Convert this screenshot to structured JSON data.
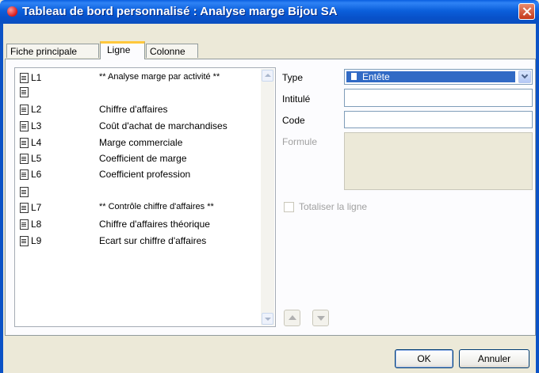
{
  "window": {
    "title": "Tableau de bord personnalisé : Analyse marge Bijou SA"
  },
  "tabs": [
    {
      "label": "Fiche principale"
    },
    {
      "label": "Ligne"
    },
    {
      "label": "Colonne"
    }
  ],
  "lines": [
    {
      "code": "L1",
      "label": "** Analyse marge par activité **"
    },
    {
      "code": "",
      "label": ""
    },
    {
      "code": "L2",
      "label": "Chiffre d'affaires"
    },
    {
      "code": "L3",
      "label": "Coût d'achat de marchandises"
    },
    {
      "code": "L4",
      "label": "Marge commerciale"
    },
    {
      "code": "L5",
      "label": "Coefficient de marge"
    },
    {
      "code": "L6",
      "label": "Coefficient profession"
    },
    {
      "code": "",
      "label": ""
    },
    {
      "code": "L7",
      "label": "** Contrôle chiffre d'affaires **"
    },
    {
      "code": "L8",
      "label": "Chiffre d'affaires théorique"
    },
    {
      "code": "L9",
      "label": "Ecart sur chiffre d'affaires"
    }
  ],
  "form": {
    "type_label": "Type",
    "type_value": "Entête",
    "intitule_label": "Intitulé",
    "intitule_value": "",
    "code_label": "Code",
    "code_value": "",
    "formule_label": "Formule",
    "totaliser_label": "Totaliser la ligne"
  },
  "buttons": {
    "ok": "OK",
    "annuler": "Annuler"
  },
  "colors": {
    "titlebar": "#0b5fdb",
    "selection": "#316ac5",
    "tab_highlight": "#ffc83c"
  }
}
